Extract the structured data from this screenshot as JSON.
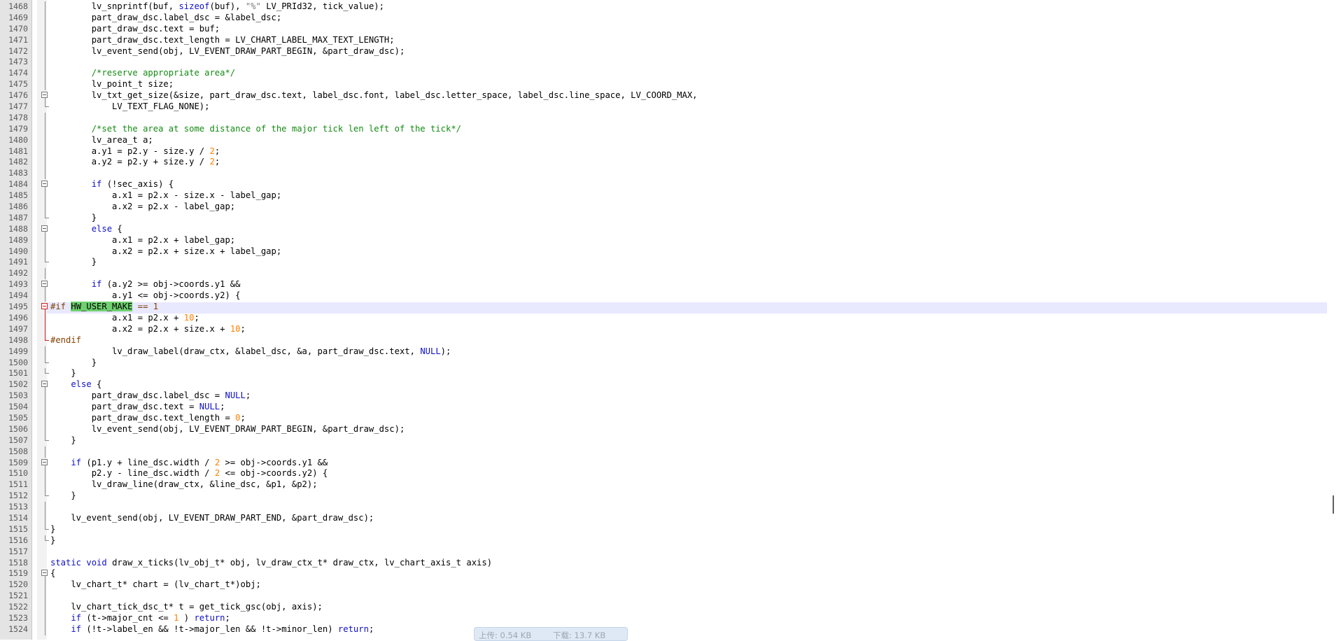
{
  "editor": {
    "lines": [
      {
        "n": "1468",
        "fold": "line",
        "segs": [
          [
            "",
            "        lv_snprintf(buf, "
          ],
          [
            "kw",
            "sizeof"
          ],
          [
            "",
            "(buf), "
          ],
          [
            "str",
            "\"%\""
          ],
          [
            "",
            " LV_PRId32, tick_value);"
          ]
        ]
      },
      {
        "n": "1469",
        "fold": "line",
        "segs": [
          [
            "",
            "        part_draw_dsc.label_dsc = &label_dsc;"
          ]
        ]
      },
      {
        "n": "1470",
        "fold": "line",
        "segs": [
          [
            "",
            "        part_draw_dsc.text = buf;"
          ]
        ]
      },
      {
        "n": "1471",
        "fold": "line",
        "segs": [
          [
            "",
            "        part_draw_dsc.text_length = LV_CHART_LABEL_MAX_TEXT_LENGTH;"
          ]
        ]
      },
      {
        "n": "1472",
        "fold": "line",
        "segs": [
          [
            "",
            "        lv_event_send(obj, LV_EVENT_DRAW_PART_BEGIN, &part_draw_dsc);"
          ]
        ]
      },
      {
        "n": "1473",
        "fold": "line",
        "segs": [
          [
            "",
            ""
          ]
        ]
      },
      {
        "n": "1474",
        "fold": "line",
        "segs": [
          [
            "cm",
            "        /*reserve appropriate area*/"
          ]
        ]
      },
      {
        "n": "1475",
        "fold": "line",
        "segs": [
          [
            "",
            "        lv_point_t size;"
          ]
        ]
      },
      {
        "n": "1476",
        "fold": "open",
        "segs": [
          [
            "",
            "        lv_txt_get_size(&size, part_draw_dsc.text, label_dsc.font, label_dsc.letter_space, label_dsc.line_space, LV_COORD_MAX,"
          ]
        ]
      },
      {
        "n": "1477",
        "fold": "end",
        "segs": [
          [
            "",
            "            LV_TEXT_FLAG_NONE);"
          ]
        ]
      },
      {
        "n": "1478",
        "fold": "line",
        "segs": [
          [
            "",
            ""
          ]
        ]
      },
      {
        "n": "1479",
        "fold": "line",
        "segs": [
          [
            "cm",
            "        /*set the area at some distance of the major tick len left of the tick*/"
          ]
        ]
      },
      {
        "n": "1480",
        "fold": "line",
        "segs": [
          [
            "",
            "        lv_area_t a;"
          ]
        ]
      },
      {
        "n": "1481",
        "fold": "line",
        "segs": [
          [
            "",
            "        a.y1 = p2.y - size.y / "
          ],
          [
            "num",
            "2"
          ],
          [
            "",
            ";"
          ]
        ]
      },
      {
        "n": "1482",
        "fold": "line",
        "segs": [
          [
            "",
            "        a.y2 = p2.y + size.y / "
          ],
          [
            "num",
            "2"
          ],
          [
            "",
            ";"
          ]
        ]
      },
      {
        "n": "1483",
        "fold": "line",
        "segs": [
          [
            "",
            ""
          ]
        ]
      },
      {
        "n": "1484",
        "fold": "open",
        "segs": [
          [
            "kw",
            "        if"
          ],
          [
            "",
            " (!sec_axis) {"
          ]
        ]
      },
      {
        "n": "1485",
        "fold": "line",
        "segs": [
          [
            "",
            "            a.x1 = p2.x - size.x - label_gap;"
          ]
        ]
      },
      {
        "n": "1486",
        "fold": "line",
        "segs": [
          [
            "",
            "            a.x2 = p2.x - label_gap;"
          ]
        ]
      },
      {
        "n": "1487",
        "fold": "end",
        "segs": [
          [
            "",
            "        }"
          ]
        ]
      },
      {
        "n": "1488",
        "fold": "open",
        "segs": [
          [
            "kw",
            "        else"
          ],
          [
            "",
            " {"
          ]
        ]
      },
      {
        "n": "1489",
        "fold": "line",
        "segs": [
          [
            "",
            "            a.x1 = p2.x + label_gap;"
          ]
        ]
      },
      {
        "n": "1490",
        "fold": "line",
        "segs": [
          [
            "",
            "            a.x2 = p2.x + size.x + label_gap;"
          ]
        ]
      },
      {
        "n": "1491",
        "fold": "end",
        "segs": [
          [
            "",
            "        }"
          ]
        ]
      },
      {
        "n": "1492",
        "fold": "line",
        "segs": [
          [
            "",
            ""
          ]
        ]
      },
      {
        "n": "1493",
        "fold": "open",
        "segs": [
          [
            "kw",
            "        if"
          ],
          [
            "",
            " (a.y2 >= obj->coords.y1 &&"
          ]
        ]
      },
      {
        "n": "1494",
        "fold": "line",
        "segs": [
          [
            "",
            "            a.y1 <= obj->coords.y2) {"
          ]
        ]
      },
      {
        "n": "1495",
        "fold": "open-red",
        "segs": [
          [
            "pp",
            "#if "
          ],
          [
            "hl",
            "HW_USER_MAKE"
          ],
          [
            "pp",
            " == 1"
          ]
        ]
      },
      {
        "n": "1496",
        "fold": "line-red",
        "segs": [
          [
            "",
            "            a.x1 = p2.x + "
          ],
          [
            "num",
            "10"
          ],
          [
            "",
            ";"
          ]
        ]
      },
      {
        "n": "1497",
        "fold": "line-red",
        "segs": [
          [
            "",
            "            a.x2 = p2.x + size.x + "
          ],
          [
            "num",
            "10"
          ],
          [
            "",
            ";"
          ]
        ]
      },
      {
        "n": "1498",
        "fold": "end-red",
        "segs": [
          [
            "pp",
            "#endif"
          ]
        ]
      },
      {
        "n": "1499",
        "fold": "line",
        "segs": [
          [
            "",
            "            lv_draw_label(draw_ctx, &label_dsc, &a, part_draw_dsc.text, "
          ],
          [
            "kw",
            "NULL"
          ],
          [
            "",
            ");"
          ]
        ]
      },
      {
        "n": "1500",
        "fold": "end",
        "segs": [
          [
            "",
            "        }"
          ]
        ]
      },
      {
        "n": "1501",
        "fold": "end",
        "segs": [
          [
            "",
            "    }"
          ]
        ]
      },
      {
        "n": "1502",
        "fold": "open",
        "segs": [
          [
            "kw",
            "    else"
          ],
          [
            "",
            " {"
          ]
        ]
      },
      {
        "n": "1503",
        "fold": "line",
        "segs": [
          [
            "",
            "        part_draw_dsc.label_dsc = "
          ],
          [
            "kw",
            "NULL"
          ],
          [
            "",
            ";"
          ]
        ]
      },
      {
        "n": "1504",
        "fold": "line",
        "segs": [
          [
            "",
            "        part_draw_dsc.text = "
          ],
          [
            "kw",
            "NULL"
          ],
          [
            "",
            ";"
          ]
        ]
      },
      {
        "n": "1505",
        "fold": "line",
        "segs": [
          [
            "",
            "        part_draw_dsc.text_length = "
          ],
          [
            "num",
            "0"
          ],
          [
            "",
            ";"
          ]
        ]
      },
      {
        "n": "1506",
        "fold": "line",
        "segs": [
          [
            "",
            "        lv_event_send(obj, LV_EVENT_DRAW_PART_BEGIN, &part_draw_dsc);"
          ]
        ]
      },
      {
        "n": "1507",
        "fold": "end",
        "segs": [
          [
            "",
            "    }"
          ]
        ]
      },
      {
        "n": "1508",
        "fold": "line",
        "segs": [
          [
            "",
            ""
          ]
        ]
      },
      {
        "n": "1509",
        "fold": "open",
        "segs": [
          [
            "kw",
            "    if"
          ],
          [
            "",
            " (p1.y + line_dsc.width / "
          ],
          [
            "num",
            "2"
          ],
          [
            "",
            " >= obj->coords.y1 &&"
          ]
        ]
      },
      {
        "n": "1510",
        "fold": "line",
        "segs": [
          [
            "",
            "        p2.y - line_dsc.width / "
          ],
          [
            "num",
            "2"
          ],
          [
            "",
            " <= obj->coords.y2) {"
          ]
        ]
      },
      {
        "n": "1511",
        "fold": "line",
        "segs": [
          [
            "",
            "        lv_draw_line(draw_ctx, &line_dsc, &p1, &p2);"
          ]
        ]
      },
      {
        "n": "1512",
        "fold": "end",
        "segs": [
          [
            "",
            "    }"
          ]
        ]
      },
      {
        "n": "1513",
        "fold": "line",
        "segs": [
          [
            "",
            ""
          ]
        ]
      },
      {
        "n": "1514",
        "fold": "line",
        "segs": [
          [
            "",
            "    lv_event_send(obj, LV_EVENT_DRAW_PART_END, &part_draw_dsc);"
          ]
        ]
      },
      {
        "n": "1515",
        "fold": "end",
        "segs": [
          [
            "",
            "}"
          ]
        ]
      },
      {
        "n": "1516",
        "fold": "end",
        "segs": [
          [
            "",
            "}"
          ]
        ]
      },
      {
        "n": "1517",
        "fold": "none",
        "segs": [
          [
            "",
            ""
          ]
        ]
      },
      {
        "n": "1518",
        "fold": "none",
        "segs": [
          [
            "kw",
            "static"
          ],
          [
            "",
            " "
          ],
          [
            "kw",
            "void"
          ],
          [
            "",
            " draw_x_ticks(lv_obj_t* obj, lv_draw_ctx_t* draw_ctx, lv_chart_axis_t axis)"
          ]
        ]
      },
      {
        "n": "1519",
        "fold": "open",
        "segs": [
          [
            "",
            "{"
          ]
        ]
      },
      {
        "n": "1520",
        "fold": "line",
        "segs": [
          [
            "",
            "    lv_chart_t* chart = (lv_chart_t*)obj;"
          ]
        ]
      },
      {
        "n": "1521",
        "fold": "line",
        "segs": [
          [
            "",
            ""
          ]
        ]
      },
      {
        "n": "1522",
        "fold": "line",
        "segs": [
          [
            "",
            "    lv_chart_tick_dsc_t* t = get_tick_gsc(obj, axis);"
          ]
        ]
      },
      {
        "n": "1523",
        "fold": "line",
        "segs": [
          [
            "kw",
            "    if"
          ],
          [
            "",
            " (t->major_cnt <= "
          ],
          [
            "num",
            "1"
          ],
          [
            "",
            " ) "
          ],
          [
            "kw",
            "return"
          ],
          [
            "",
            ";"
          ]
        ]
      },
      {
        "n": "1524",
        "fold": "line",
        "segs": [
          [
            "kw",
            "    if"
          ],
          [
            "",
            " (!t->label_en && !t->major_len && !t->minor_len) "
          ],
          [
            "kw",
            "return"
          ],
          [
            "",
            ";"
          ]
        ]
      }
    ]
  },
  "status": {
    "upload": "上传: 0.54 KB",
    "download": "下载: 13.7 KB"
  }
}
